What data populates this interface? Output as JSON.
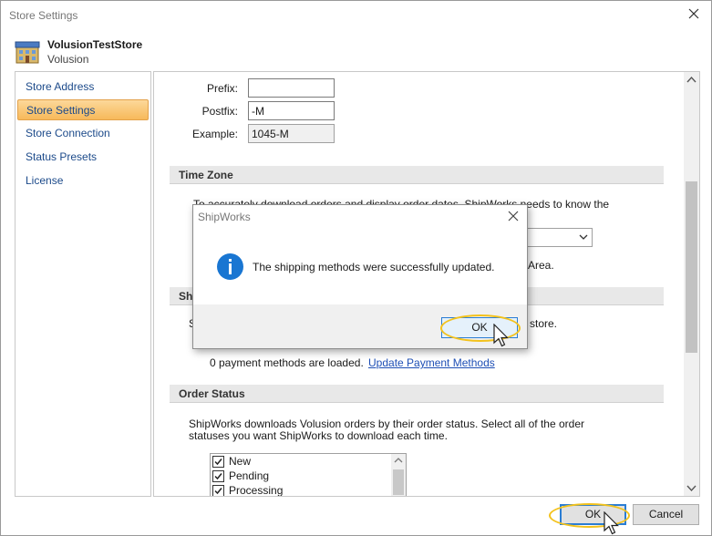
{
  "window": {
    "title": "Store Settings"
  },
  "store": {
    "name": "VolusionTestStore",
    "platform": "Volusion"
  },
  "nav": {
    "items": [
      {
        "label": "Store Address"
      },
      {
        "label": "Store Settings"
      },
      {
        "label": "Store Connection"
      },
      {
        "label": "Status Presets"
      },
      {
        "label": "License"
      }
    ],
    "selected": "Store Settings"
  },
  "order_number": {
    "prefix_label": "Prefix:",
    "prefix_value": "",
    "postfix_label": "Postfix:",
    "postfix_value": "-M",
    "example_label": "Example:",
    "example_value": "1045-M"
  },
  "time_zone": {
    "header": "Time Zone",
    "text_fragment": "To accurately download orders and display order dates, ShipWorks needs to know the",
    "partial_text": "Area."
  },
  "shipping": {
    "header_fragment": "Ship",
    "left_fragment": "S",
    "right_fragment": "store.",
    "payment_status": "0 payment methods are loaded.",
    "update_link": "Update Payment Methods"
  },
  "order_status": {
    "header": "Order Status",
    "description_line1": "ShipWorks downloads Volusion orders by their order status. Select all of the order",
    "description_line2": "statuses you want ShipWorks to download each time.",
    "statuses": [
      {
        "label": "New",
        "checked": true
      },
      {
        "label": "Pending",
        "checked": true
      },
      {
        "label": "Processing",
        "checked": true
      }
    ]
  },
  "footer": {
    "ok_label": "OK",
    "cancel_label": "Cancel"
  },
  "dialog": {
    "title": "ShipWorks",
    "message": "The shipping methods were successfully updated.",
    "ok_label": "OK"
  },
  "colors": {
    "accent_blue": "#2a7dd4",
    "highlight_ring": "#f3c21c",
    "selection_orange": "#f7b95a",
    "info_icon": "#1976d2"
  },
  "icons": [
    "store-building-icon",
    "close-icon",
    "info-icon",
    "chevron-down-icon",
    "checkmark-icon",
    "mouse-cursor-icon"
  ]
}
